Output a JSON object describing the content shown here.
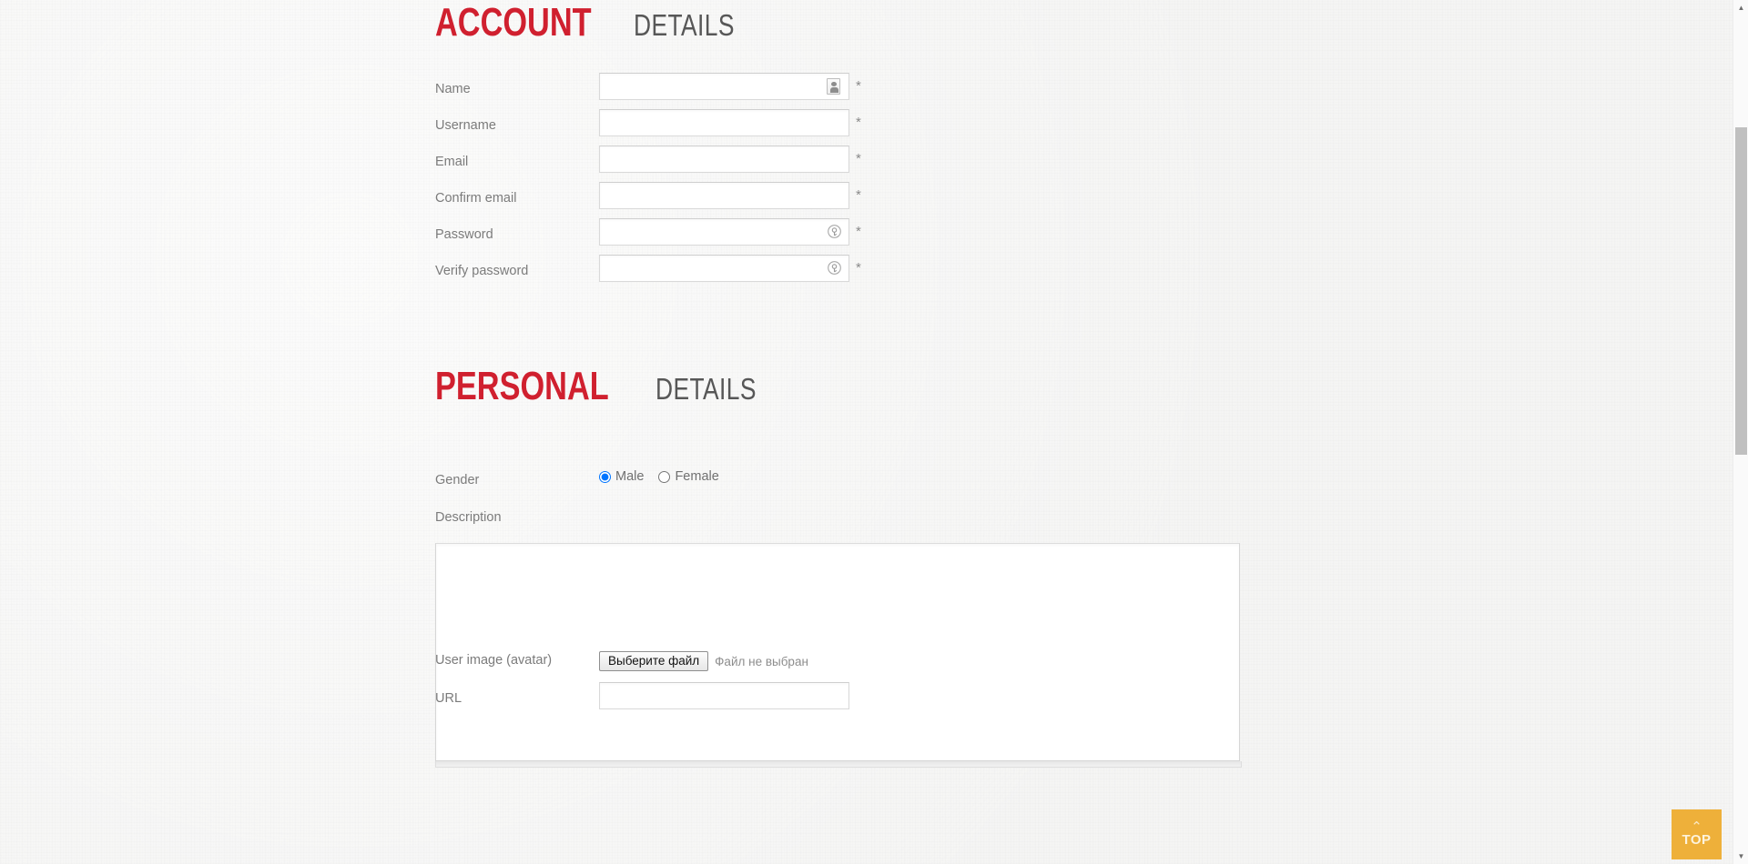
{
  "page": {
    "background_color": "#f5f5f4",
    "accent_color": "#d0202f",
    "top_button_color": "#eeb03a"
  },
  "sections": {
    "account": {
      "strong": "ACCOUNT",
      "light": "DETAILS"
    },
    "personal": {
      "strong": "PERSONAL",
      "light": "DETAILS"
    }
  },
  "account_fields": [
    {
      "label": "Name",
      "value": "",
      "placeholder": "",
      "required_marker": "*",
      "icon": "contact-card-icon"
    },
    {
      "label": "Username",
      "value": "",
      "placeholder": "",
      "required_marker": "*",
      "icon": ""
    },
    {
      "label": "Email",
      "value": "",
      "placeholder": "",
      "required_marker": "*",
      "icon": ""
    },
    {
      "label": "Confirm email",
      "value": "",
      "placeholder": "",
      "required_marker": "*",
      "icon": ""
    },
    {
      "label": "Password",
      "value": "",
      "placeholder": "",
      "required_marker": "*",
      "icon": "reveal-password-icon"
    },
    {
      "label": "Verify password",
      "value": "",
      "placeholder": "",
      "required_marker": "*",
      "icon": "reveal-password-icon"
    }
  ],
  "personal": {
    "gender": {
      "label": "Gender",
      "options": [
        {
          "label": "Male",
          "checked": true
        },
        {
          "label": "Female",
          "checked": false
        }
      ]
    },
    "description": {
      "label": "Description",
      "value": "",
      "placeholder": ""
    },
    "avatar": {
      "label": "User image (avatar)",
      "button_label": "Выберите файл",
      "status_text": "Файл не выбран"
    },
    "url": {
      "label": "URL",
      "value": "",
      "placeholder": ""
    }
  },
  "back_to_top": {
    "label": "TOP",
    "chevron": "⌃"
  },
  "scrollbar": {
    "up_arrow": "▲",
    "down_arrow": "▼"
  }
}
